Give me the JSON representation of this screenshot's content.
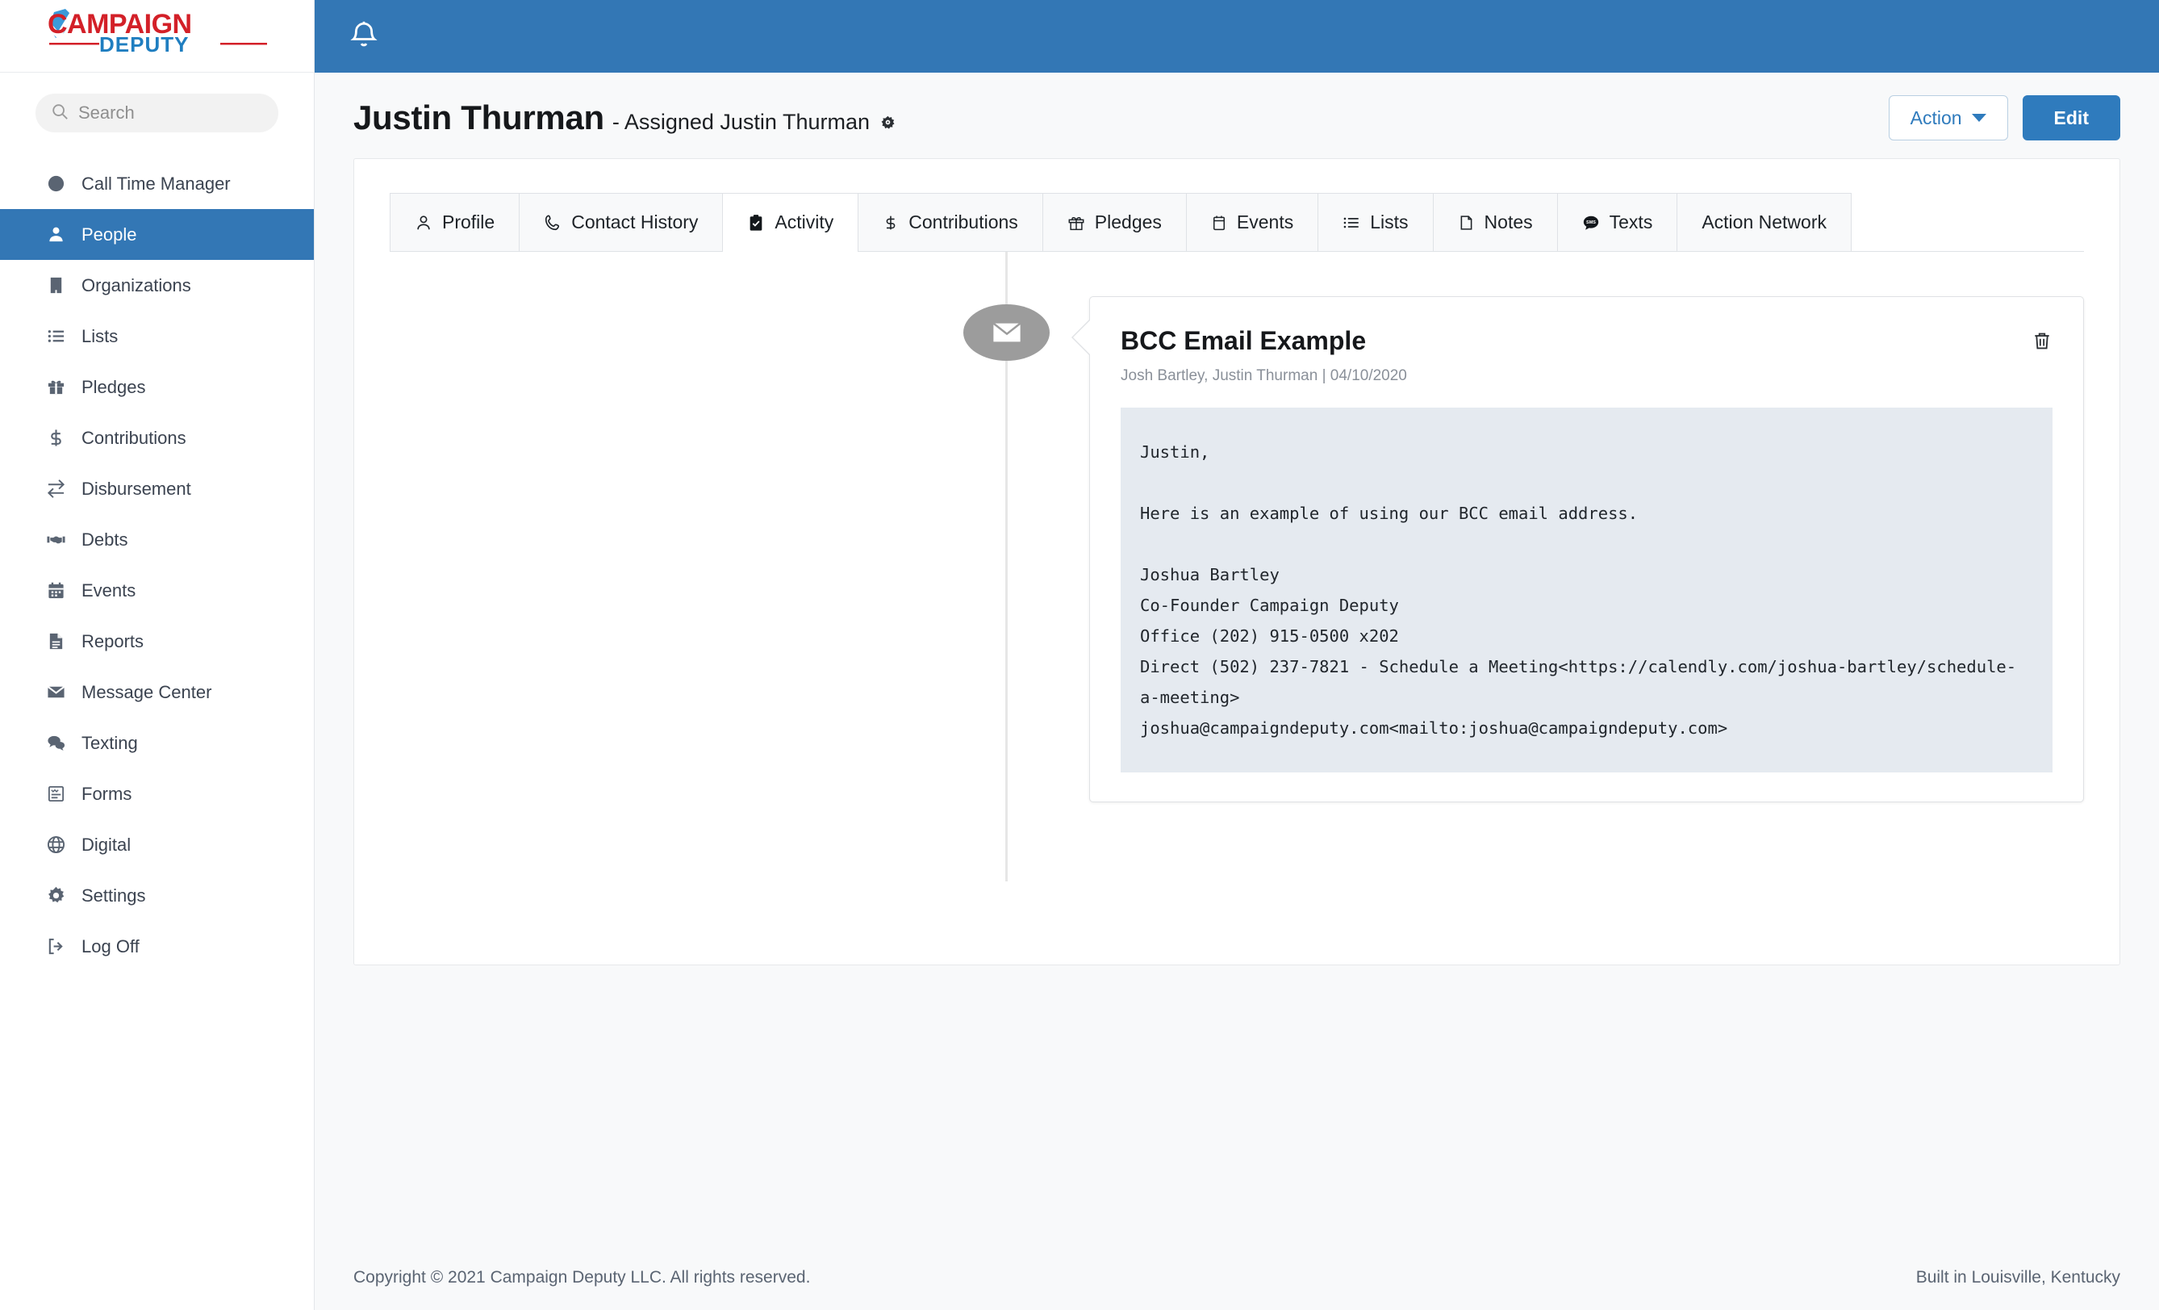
{
  "brand": {
    "name_top": "CAMPAIGN",
    "name_bottom": "DEPUTY",
    "red": "#d32028",
    "blue": "#1f7ec0"
  },
  "colors": {
    "accent_blue": "#3377B5",
    "button_blue": "#2f7bbd",
    "email_bg": "#e5eaf0",
    "timeline_dot": "#9c9c9c"
  },
  "search": {
    "placeholder": "Search",
    "value": "",
    "icon": "search-icon"
  },
  "topbar": {
    "notification_icon": "bell-icon"
  },
  "sidebar": {
    "items": [
      {
        "label": "Call Time Manager",
        "icon": "clock-icon",
        "active": false
      },
      {
        "label": "People",
        "icon": "user-icon",
        "active": true
      },
      {
        "label": "Organizations",
        "icon": "building-icon",
        "active": false
      },
      {
        "label": "Lists",
        "icon": "list-icon",
        "active": false
      },
      {
        "label": "Pledges",
        "icon": "gift-icon",
        "active": false
      },
      {
        "label": "Contributions",
        "icon": "dollar-icon",
        "active": false
      },
      {
        "label": "Disbursement",
        "icon": "exchange-icon",
        "active": false
      },
      {
        "label": "Debts",
        "icon": "handshake-icon",
        "active": false
      },
      {
        "label": "Events",
        "icon": "calendar-icon",
        "active": false
      },
      {
        "label": "Reports",
        "icon": "file-text-icon",
        "active": false
      },
      {
        "label": "Message Center",
        "icon": "envelope-icon",
        "active": false
      },
      {
        "label": "Texting",
        "icon": "comments-icon",
        "active": false
      },
      {
        "label": "Forms",
        "icon": "clipboard-list-icon",
        "active": false
      },
      {
        "label": "Digital",
        "icon": "globe-icon",
        "active": false
      },
      {
        "label": "Settings",
        "icon": "gear-icon",
        "active": false
      },
      {
        "label": "Log Off",
        "icon": "sign-out-icon",
        "active": false
      }
    ]
  },
  "page": {
    "title": "Justin Thurman",
    "subtitle": "- Assigned Justin Thurman",
    "settings_icon": "gear-small-icon"
  },
  "actions": {
    "action_label": "Action",
    "action_caret": "chevron-down-icon",
    "edit_label": "Edit"
  },
  "tabs": [
    {
      "label": "Profile",
      "icon": "user-outline-icon",
      "active": false
    },
    {
      "label": "Contact History",
      "icon": "phone-icon",
      "active": false
    },
    {
      "label": "Activity",
      "icon": "clipboard-check-icon",
      "active": true
    },
    {
      "label": "Contributions",
      "icon": "dollar-icon",
      "active": false
    },
    {
      "label": "Pledges",
      "icon": "gift-icon",
      "active": false
    },
    {
      "label": "Events",
      "icon": "calendar-outline-icon",
      "active": false
    },
    {
      "label": "Lists",
      "icon": "list-icon",
      "active": false
    },
    {
      "label": "Notes",
      "icon": "note-icon",
      "active": false
    },
    {
      "label": "Texts",
      "icon": "sms-bubble-icon",
      "active": false
    },
    {
      "label": "Action Network",
      "icon": "",
      "active": false
    }
  ],
  "activity": {
    "marker_icon": "envelope-icon",
    "title": "BCC Email Example",
    "meta": "Josh Bartley, Justin Thurman | 04/10/2020",
    "delete_icon": "trash-icon",
    "body": "Justin,\n\nHere is an example of using our BCC email address.\n\nJoshua Bartley\nCo-Founder Campaign Deputy\nOffice (202) 915-0500 x202\nDirect (502) 237-7821 - Schedule a Meeting<https://calendly.com/joshua-bartley/schedule-a-meeting>\njoshua@campaigndeputy.com<mailto:joshua@campaigndeputy.com>"
  },
  "footer": {
    "copyright": "Copyright © 2021 Campaign Deputy LLC. All rights reserved.",
    "built": "Built in Louisville, Kentucky"
  }
}
